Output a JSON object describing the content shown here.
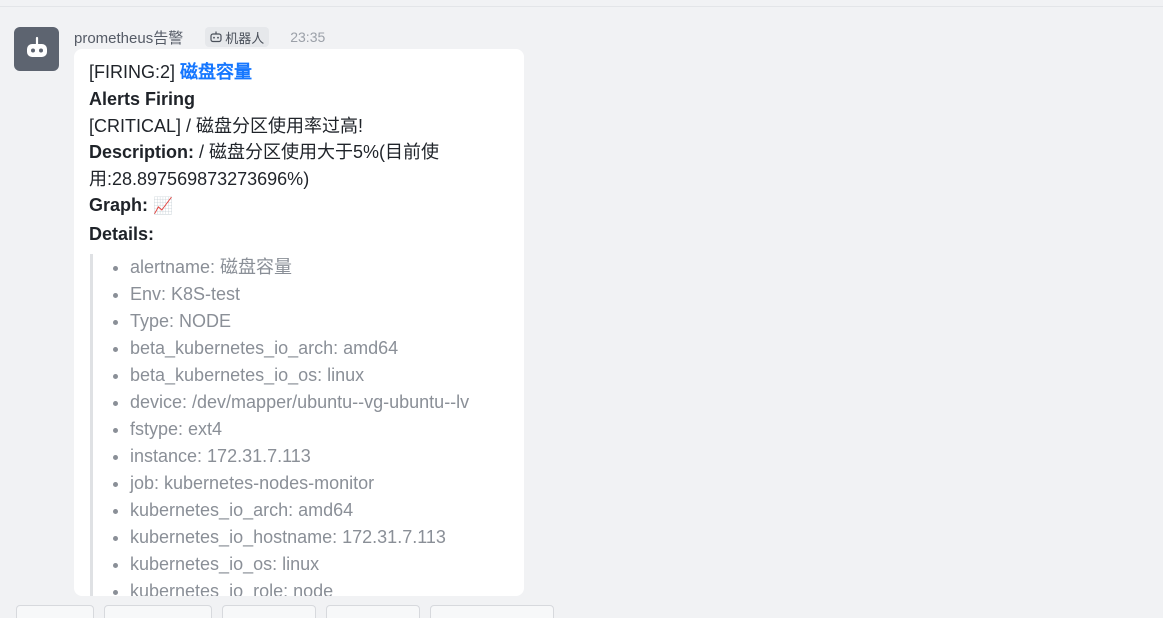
{
  "message": {
    "sender": "prometheus告警",
    "badge_label": "机器人",
    "time": "23:35",
    "title_prefix": "[FIRING:2]",
    "title_link": "磁盘容量",
    "heading": "Alerts Firing",
    "summary": "[CRITICAL] / 磁盘分区使用率过高!",
    "description_label": "Description:",
    "description_text": " / 磁盘分区使用大于5%(目前使用:28.897569873273696%)",
    "graph_label": "Graph:",
    "graph_icon": "📈",
    "details_label": "Details:",
    "details": [
      "alertname: 磁盘容量",
      "Env: K8S-test",
      "Type: NODE",
      "beta_kubernetes_io_arch: amd64",
      "beta_kubernetes_io_os: linux",
      "device: /dev/mapper/ubuntu--vg-ubuntu--lv",
      "fstype: ext4",
      "instance: 172.31.7.113",
      "job: kubernetes-nodes-monitor",
      "kubernetes_io_arch: amd64",
      "kubernetes_io_hostname: 172.31.7.113",
      "kubernetes_io_os: linux",
      "kubernetes_io_role: node"
    ]
  },
  "colors": {
    "background": "#f1f2f4",
    "bubble": "#ffffff",
    "link": "#1677ff",
    "avatar": "#5d6470",
    "detail_text": "#8a8f97"
  },
  "icons": {
    "avatar": "robot-icon",
    "badge": "robot-icon",
    "graph": "chart-increasing-icon"
  }
}
